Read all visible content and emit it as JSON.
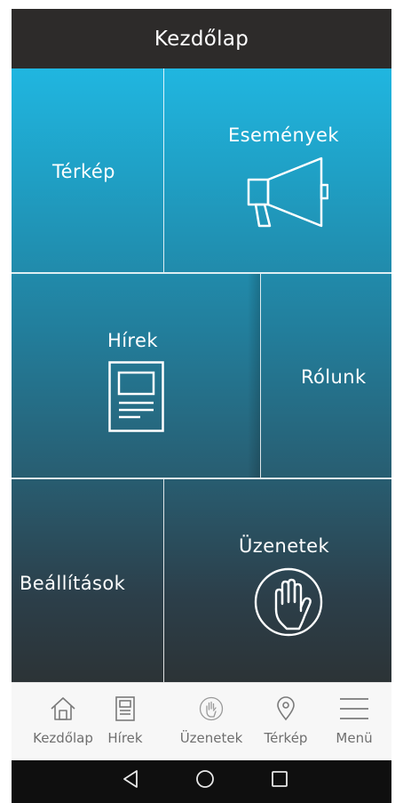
{
  "header": {
    "title": "Kezdőlap"
  },
  "tiles": {
    "map": {
      "label": "Térkép"
    },
    "events": {
      "label": "Események"
    },
    "news": {
      "label": "Hírek"
    },
    "about": {
      "label": "Rólunk"
    },
    "settings": {
      "label": "Beállítások"
    },
    "messages": {
      "label": "Üzenetek"
    }
  },
  "bottom_nav": {
    "home": {
      "label": "Kezdőlap",
      "icon": "home-icon"
    },
    "news": {
      "label": "Hírek",
      "icon": "news-icon"
    },
    "messages": {
      "label": "Üzenetek",
      "icon": "hand-icon"
    },
    "map": {
      "label": "Térkép",
      "icon": "map-pin-icon"
    },
    "menu": {
      "label": "Menü",
      "icon": "hamburger-icon"
    }
  },
  "system_nav": {
    "back": {
      "icon": "back-triangle-icon"
    },
    "home": {
      "icon": "home-circle-icon"
    },
    "recents": {
      "icon": "recents-square-icon"
    }
  },
  "colors": {
    "header_bg": "#2d2b2a",
    "tile_top": "#20b6e0",
    "tile_bottom": "#2c3336",
    "bottom_bar": "#f7f7f7",
    "system_bar": "#0f0f0f"
  }
}
